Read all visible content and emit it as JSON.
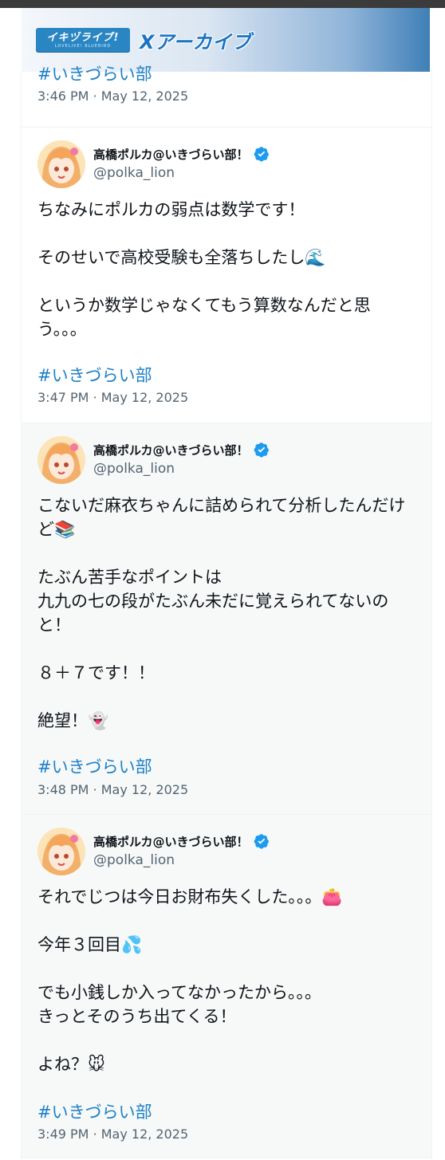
{
  "header": {
    "logo_text": "イキヅライブ!",
    "logo_subtext": "LOVELIVE! BLUEBIRD",
    "title": "Xアーカイブ"
  },
  "tweets": [
    {
      "hashtag": "#いきづらい部",
      "time": "3:46 PM · May 12, 2025"
    },
    {
      "name": "高橋ポルカ@いきづらい部！",
      "handle": "@polka_lion",
      "text": "ちなみにポルカの弱点は数学です！\n\nそのせいで高校受験も全落ちしたし🌊\n\nというか数学じゃなくてもう算数なんだと思う。。。",
      "hashtag": "#いきづらい部",
      "time": "3:47 PM · May 12, 2025"
    },
    {
      "name": "高橋ポルカ@いきづらい部！",
      "handle": "@polka_lion",
      "text": "こないだ麻衣ちゃんに詰められて分析したんだけど📚\n\nたぶん苦手なポイントは\n九九の七の段がたぶん未だに覚えられてないのと！\n\n８＋７です！！\n\n絶望！👻",
      "hashtag": "#いきづらい部",
      "time": "3:48 PM · May 12, 2025"
    },
    {
      "name": "高橋ポルカ@いきづらい部！",
      "handle": "@polka_lion",
      "text": "それでじつは今日お財布失くした。。。👛\n\n今年３回目💦\n\nでも小銭しか入ってなかったから。。。\nきっとそのうち出てくる！\n\nよね？🐭",
      "hashtag": "#いきづらい部",
      "time": "3:49 PM · May 12, 2025"
    }
  ],
  "colors": {
    "hashtag": "#1d80c6",
    "secondary_text": "#536471",
    "verified": "#1d9bf0",
    "highlight_bg": "#f7f9f9"
  },
  "icons": {
    "verified": "verified-badge-icon"
  }
}
